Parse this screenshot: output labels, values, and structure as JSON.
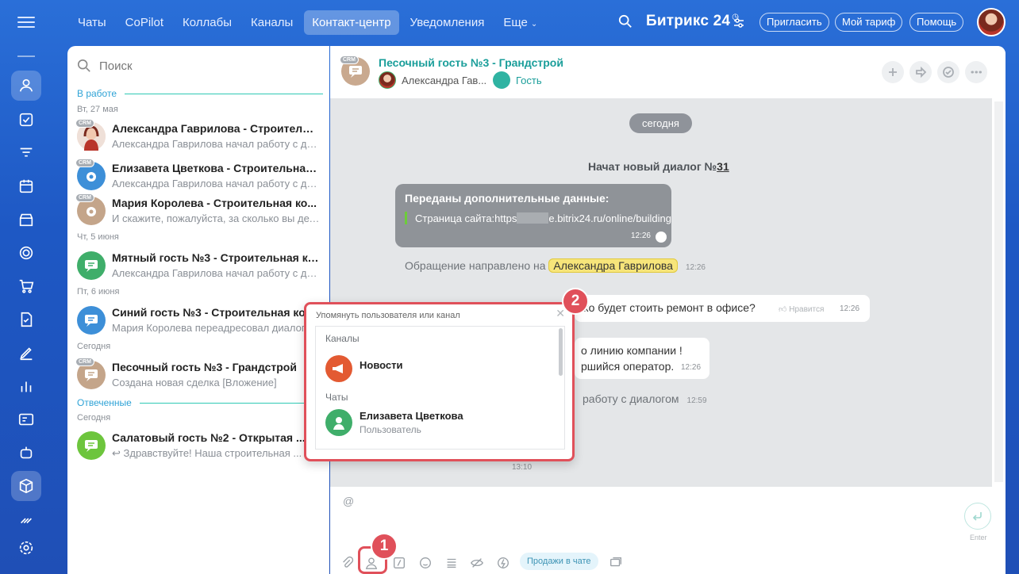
{
  "topnav": {
    "tabs": [
      "Чаты",
      "CoPilot",
      "Коллабы",
      "Каналы",
      "Контакт-центр",
      "Уведомления",
      "Еще"
    ],
    "active_index": 4,
    "brand": "Битрикс",
    "brand_num": "24",
    "invite": "Пригласить",
    "tariff": "Мой тариф",
    "help": "Помощь"
  },
  "sidebar_rail": {
    "icons": [
      "menu-icon",
      "users-icon",
      "tasks-icon",
      "filter-icon",
      "calendar-icon",
      "store-icon",
      "target-icon",
      "cart-icon",
      "sign-icon",
      "pen-icon",
      "chart-icon",
      "contact-card-icon",
      "robot-icon",
      "box-icon",
      "marketplace-icon",
      "settings-icon"
    ]
  },
  "chat_list": {
    "search_placeholder": "Поиск",
    "groups": {
      "in_work": "В работе",
      "answered": "Отвеченные"
    },
    "dates": {
      "d1": "Вт, 27 мая",
      "d2": "Чт, 5 июня",
      "d3": "Пт, 6 июня",
      "d4": "Сегодня",
      "d5": "Сегодня"
    },
    "crm_badge": "CRM",
    "items": [
      {
        "title": "Александра Гаврилова - Строительн...",
        "sub": "Александра Гаврилова начал работу с ди...",
        "color": "#c0392b"
      },
      {
        "title": "Елизавета Цветкова - Строительная ...",
        "sub": "Александра Гаврилова начал работу с ди...",
        "color": "#3d8fd8"
      },
      {
        "title": "Мария Королева - Строительная ко...",
        "sub": "И скажите, пожалуйста, за сколько вы дел...",
        "color": "#c4a58a"
      },
      {
        "title": "Мятный гость №3 - Строительная ко...",
        "sub": "Александра Гаврилова начал работу с ди...",
        "color": "#3fae6a"
      },
      {
        "title": "Синий гость №3 - Строительная ком",
        "sub": "Мария Королева переадресовал диалог",
        "color": "#3d8fd8"
      },
      {
        "title": "Песочный гость №3 - Грандстрой",
        "sub": "Создана новая сделка [Вложение]",
        "color": "#c4a58a"
      },
      {
        "title": "Салатовый гость №2 - Открытая ...",
        "sub": "Здравствуйте! Наша строительная ...",
        "color": "#6dc53d"
      }
    ]
  },
  "chat": {
    "title": "Песочный гость №3 - Грандстрой",
    "member1": "Александра Гав...",
    "member2": "Гость",
    "day": "сегодня",
    "dialog_started": "Начат новый диалог №",
    "dialog_num": "31",
    "data_title": "Переданы дополнительные данные:",
    "data_line_prefix": "Страница сайта:https",
    "data_line_suffix": "e.bitrix24.ru/online/building",
    "data_time": "12:26",
    "routed_text": "Обращение направлено на",
    "routed_to": "Александра Гаврилова",
    "routed_time": "12:26",
    "msg1": "ько будет стоить ремонт в офисе?",
    "msg1_like": "Нравится",
    "msg1_time": "12:26",
    "msg2_line1": "о линию компании !",
    "msg2_line2": "ршийся оператор.",
    "msg2_time": "12:26",
    "msg3": "работу с диалогом",
    "msg3_time": "12:59",
    "time4": "13:10"
  },
  "composer": {
    "placeholder": "@",
    "enter_hint": "Enter",
    "sales_chip": "Продажи в чате"
  },
  "mention_popup": {
    "title": "Упомянуть пользователя или канал",
    "section_channels": "Каналы",
    "channel_name": "Новости",
    "section_chats": "Чаты",
    "user_name": "Елизавета Цветкова",
    "user_role": "Пользователь"
  },
  "steps": {
    "one": "1",
    "two": "2"
  },
  "colors": {
    "accent": "#2fc9b4",
    "highlight_red": "#e0505a",
    "rail_bg": "#1f5ac8"
  }
}
